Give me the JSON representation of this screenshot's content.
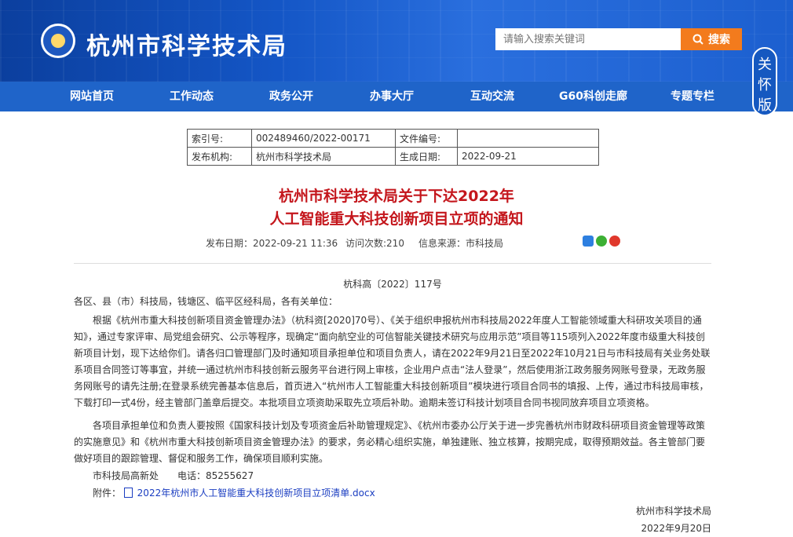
{
  "header": {
    "site_title": "杭州市科学技术局",
    "search_placeholder": "请输入搜索关键词",
    "search_button": "搜索",
    "care_mode": "关怀版"
  },
  "nav": [
    "网站首页",
    "工作动态",
    "政务公开",
    "办事大厅",
    "互动交流",
    "G60科创走廊",
    "专题专栏"
  ],
  "meta": {
    "index_label": "索引号:",
    "index_value": "002489460/2022-00171",
    "docno_label": "文件编号:",
    "docno_value": "",
    "org_label": "发布机构:",
    "org_value": "杭州市科学技术局",
    "date_label": "生成日期:",
    "date_value": "2022-09-21"
  },
  "article": {
    "title_line1": "杭州市科学技术局关于下达2022年",
    "title_line2": "人工智能重大科技创新项目立项的通知",
    "publish": "发布日期：2022-09-21 11:36",
    "visits": "访问次数:210",
    "source": "信息来源：市科技局",
    "doc_number": "杭科高〔2022〕117号",
    "salutation": "各区、县（市）科技局，钱塘区、临平区经科局，各有关单位：",
    "para1": "根据《杭州市重大科技创新项目资金管理办法》（杭科资[2020]70号）、《关于组织申报杭州市科技局2022年度人工智能领域重大科研攻关项目的通知》，通过专家评审、局党组会研究、公示等程序，现确定“面向航空业的可信智能关键技术研究与应用示范”项目等115项列入2022年度市级重大科技创新项目计划，现下达给你们。请各归口管理部门及时通知项目承担单位和项目负责人，请在2022年9月21日至2022年10月21日与市科技局有关业务处联系项目合同签订等事宜，并统一通过杭州市科技创新云服务平台进行网上审核，企业用户点击“法人登录”，然后使用浙江政务服务网账号登录，无政务服务网账号的请先注册;在登录系统完善基本信息后，首页进入“杭州市人工智能重大科技创新项目”模块进行项目合同书的填报、上传，通过市科技局审核，下载打印一式4份，经主管部门盖章后提交。本批项目立项资助采取先立项后补助。逾期未签订科技计划项目合同书视同放弃项目立项资格。",
    "para2": "各项目承担单位和负责人要按照《国家科技计划及专项资金后补助管理规定》、《杭州市委办公厅关于进一步完善杭州市财政科研项目资金管理等政策的实施意见》和《杭州市重大科技创新项目资金管理办法》的要求，务必精心组织实施，单独建账、独立核算，按期完成，取得预期效益。各主管部门要做好项目的跟踪管理、督促和服务工作，确保项目顺利实施。",
    "contact": "市科技局高新处　　电话：85255627",
    "attach_label": "附件：",
    "attach_file": "2022年杭州市人工智能重大科技创新项目立项清单.docx",
    "sign_org": "杭州市科学技术局",
    "sign_date": "2022年9月20日"
  },
  "colors": {
    "title_red": "#c4161c",
    "nav_blue": "#1f64c9",
    "search_orange": "#f37b1d"
  }
}
